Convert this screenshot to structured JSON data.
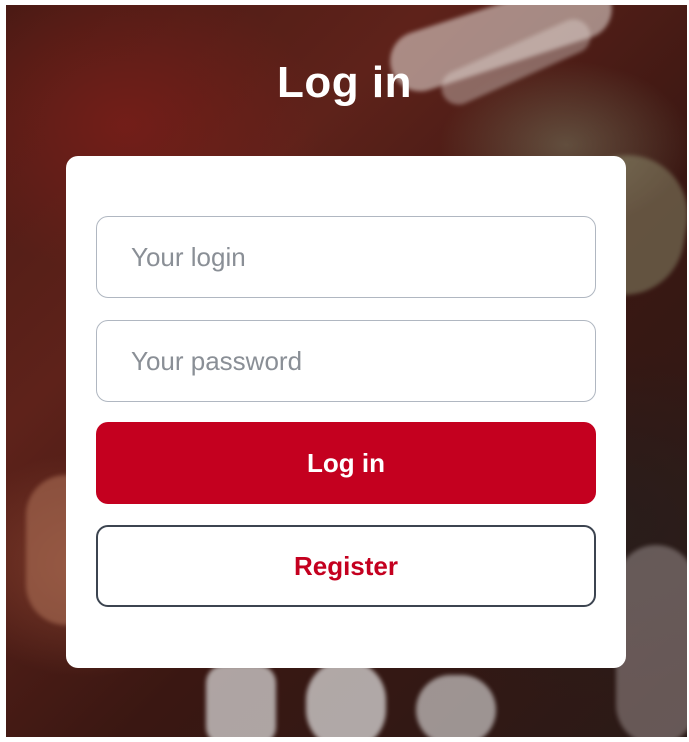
{
  "page": {
    "title": "Log in"
  },
  "form": {
    "login_placeholder": "Your login",
    "password_placeholder": "Your password",
    "login_button": "Log in",
    "register_button": "Register"
  },
  "colors": {
    "accent": "#c4001f",
    "text_light": "#ffffff",
    "placeholder": "#8a8f96",
    "border": "#b0b7c1"
  }
}
